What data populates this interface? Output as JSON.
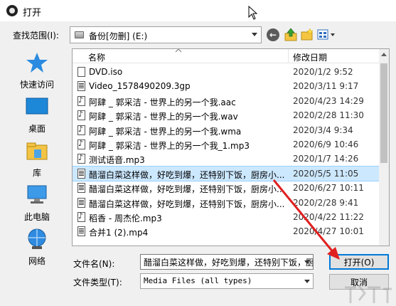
{
  "window": {
    "title": "打开"
  },
  "toolbar": {
    "look_in_label": "查找范围(I):",
    "look_in_value": "备份[勿删] (E:)",
    "back_icon": "back-arrow-icon",
    "up_icon": "up-folder-icon",
    "new_folder_icon": "new-folder-icon",
    "views_icon": "view-menu-icon"
  },
  "places": [
    {
      "label": "快速访问",
      "icon": "quick-access-star-icon"
    },
    {
      "label": "桌面",
      "icon": "desktop-icon"
    },
    {
      "label": "库",
      "icon": "library-icon"
    },
    {
      "label": "此电脑",
      "icon": "computer-icon"
    },
    {
      "label": "网络",
      "icon": "network-icon"
    }
  ],
  "file_list": {
    "columns": [
      "名称",
      "修改日期"
    ],
    "rows": [
      {
        "name": "DVD.iso",
        "date": "2020/1/2 9:52",
        "icon": "disc-file-icon"
      },
      {
        "name": "Video_1578490209.3gp",
        "date": "2020/3/11 9:17",
        "icon": "video-file-icon"
      },
      {
        "name": "阿肆 _ 郭采洁 - 世界上的另一个我.aac",
        "date": "2020/4/23 14:29",
        "icon": "audio-file-icon"
      },
      {
        "name": "阿肆 _ 郭采洁 - 世界上的另一个我.wav",
        "date": "2020/2/28 11:30",
        "icon": "audio-file-icon"
      },
      {
        "name": "阿肆 _ 郭采洁 - 世界上的另一个我.wma",
        "date": "2020/3/4 9:34",
        "icon": "audio-file-icon"
      },
      {
        "name": "阿肆 _ 郭采洁 - 世界上的另一个我_1.mp3",
        "date": "2020/6/9 10:46",
        "icon": "audio-file-icon"
      },
      {
        "name": "测试语音.mp3",
        "date": "2020/1/7 14:26",
        "icon": "audio-file-icon"
      },
      {
        "name": "醋溜白菜这样做，好吃到爆，还特别下饭，厨房小...",
        "date": "2020/5/5 11:05",
        "icon": "video-file-icon",
        "selected": true
      },
      {
        "name": "醋溜白菜这样做，好吃到爆，还特别下饭，厨房小...",
        "date": "2020/6/27 10:11",
        "icon": "video-file-icon"
      },
      {
        "name": "醋溜白菜这样做，好吃到爆，还特别下饭，厨房小...",
        "date": "2020/2/28 9:41",
        "icon": "video-file-icon"
      },
      {
        "name": "稻香 - 周杰伦.mp3",
        "date": "2020/4/22 11:22",
        "icon": "audio-file-icon"
      },
      {
        "name": "合并1 (2).mp4",
        "date": "2020/4/27 10:01",
        "icon": "video-file-icon"
      }
    ]
  },
  "bottom": {
    "filename_label": "文件名(N):",
    "filename_value": "醋溜白菜这样做，好吃到爆，还特别下饭，厨房小",
    "filetype_label": "文件类型(T):",
    "filetype_value": "Media Files (all types)",
    "open_label": "打开(O)",
    "cancel_label": "取消"
  },
  "colors": {
    "selection": "#cce8ff",
    "accent": "#0078d7",
    "annotation": "#e02020"
  }
}
